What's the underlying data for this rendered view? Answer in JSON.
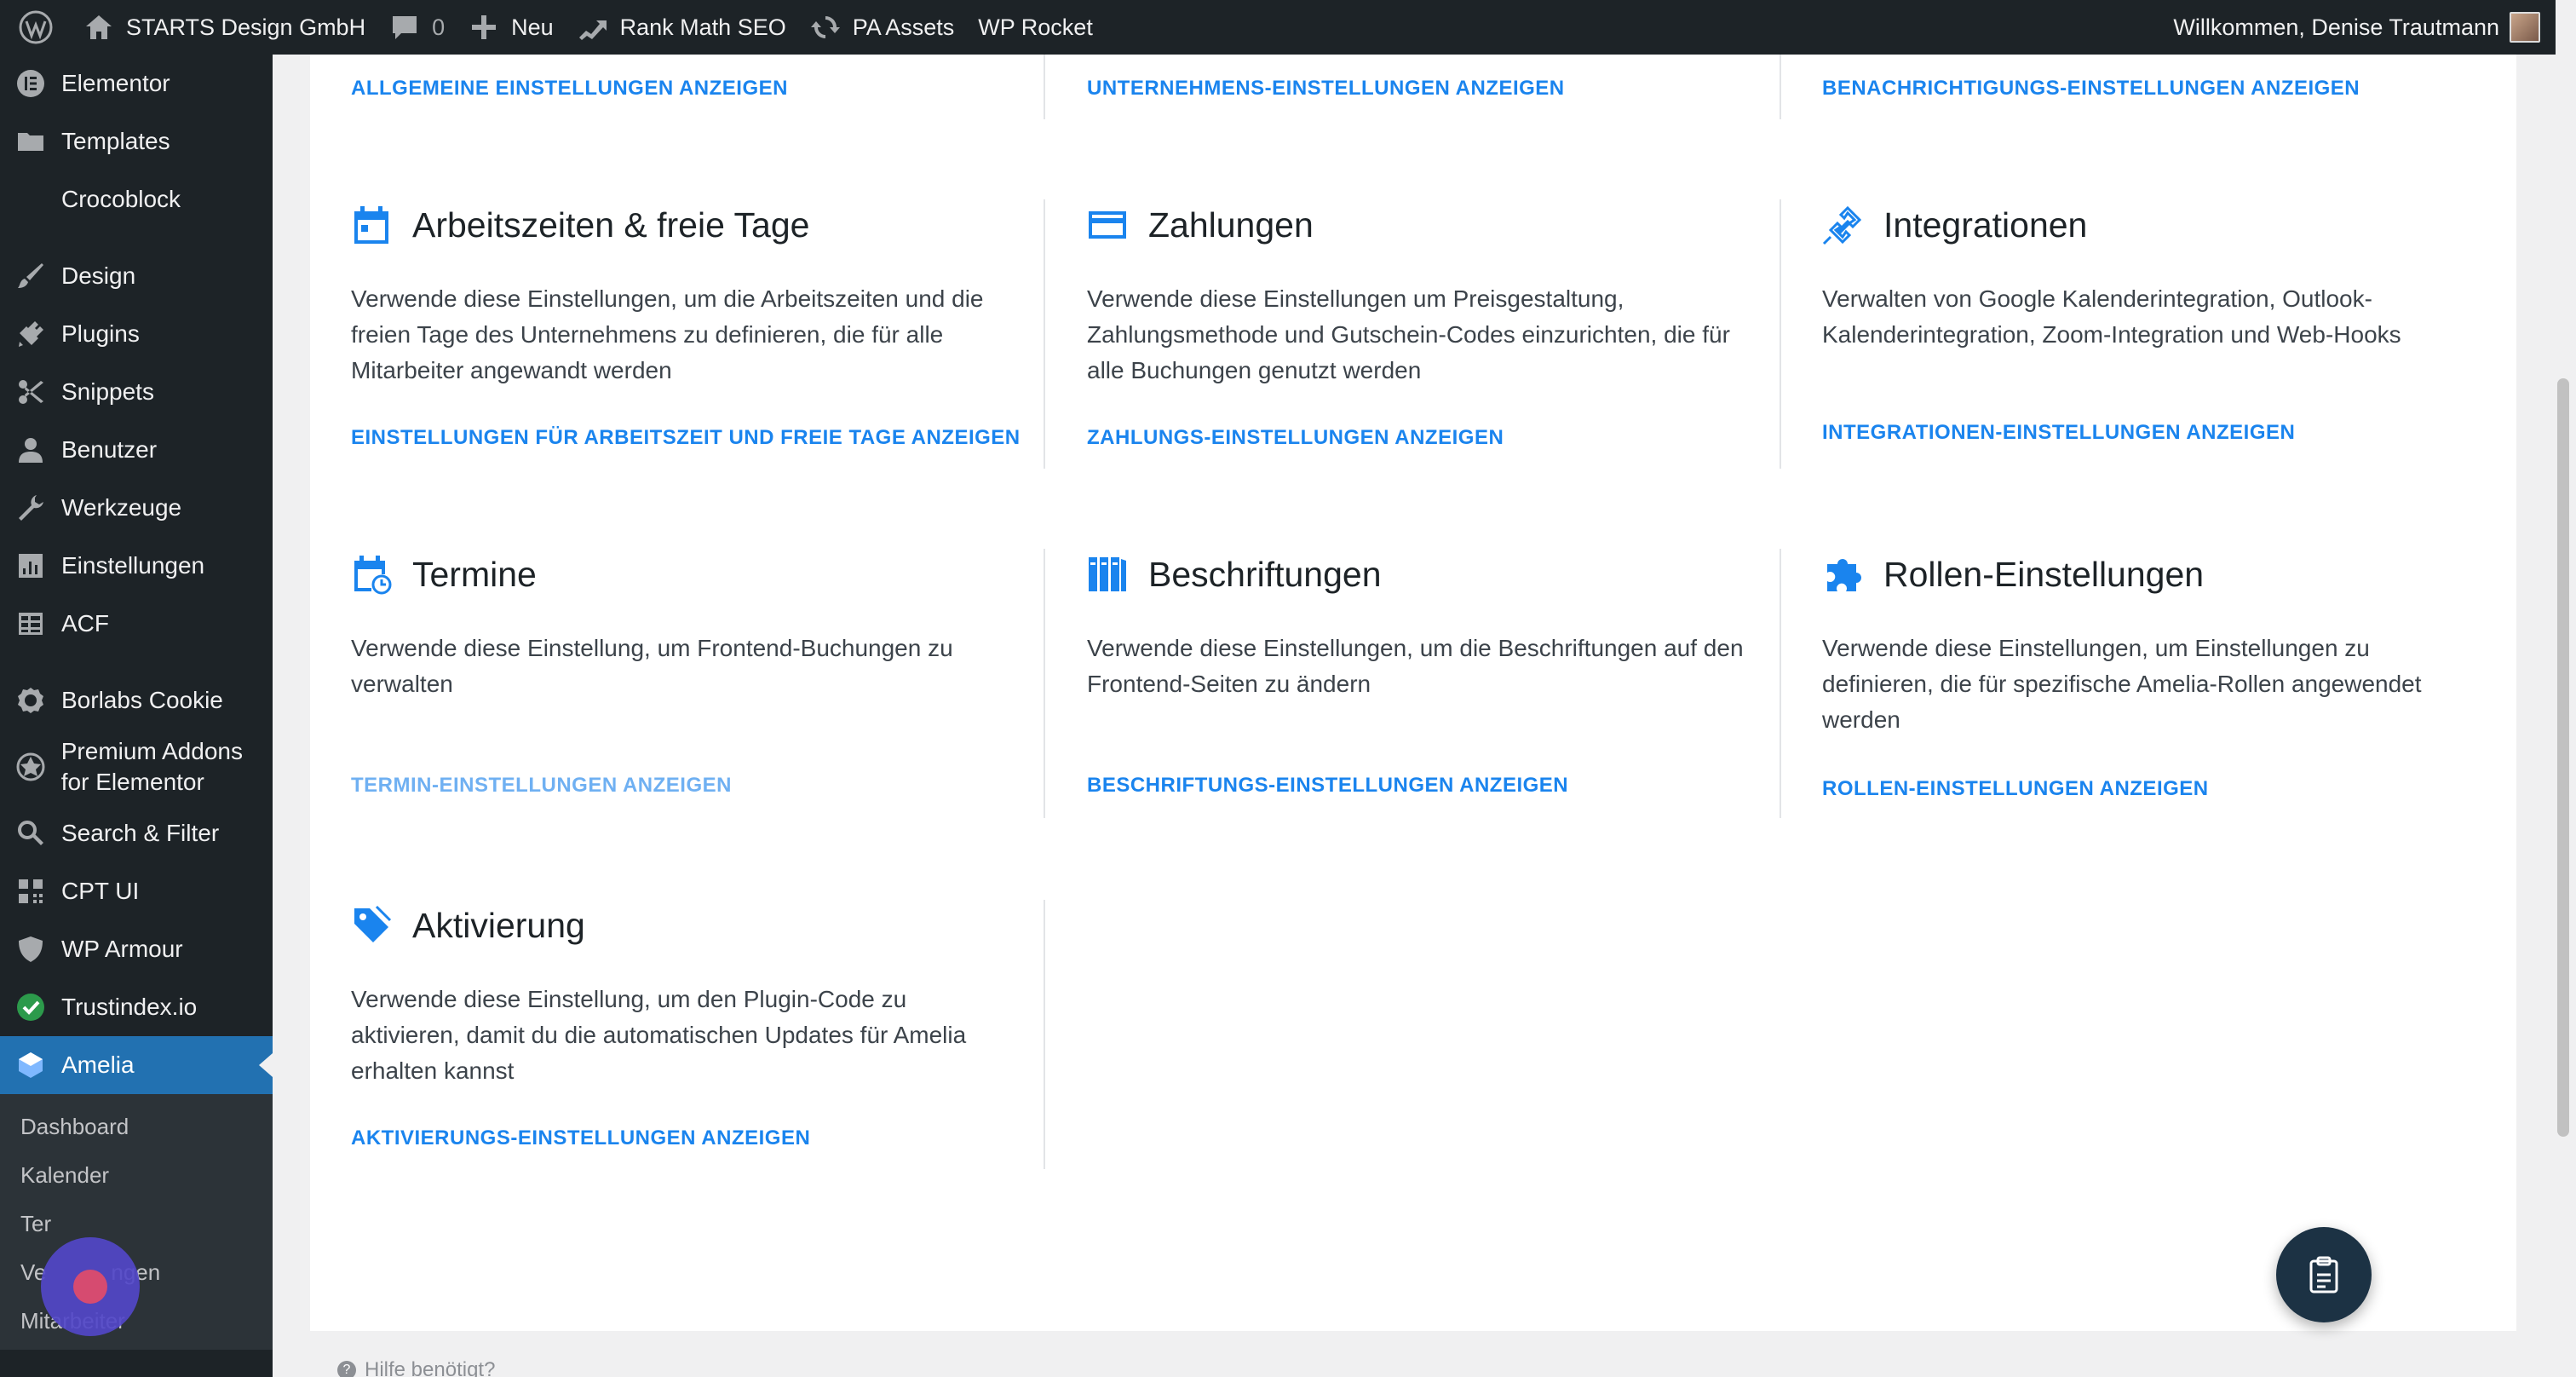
{
  "adminbar": {
    "site_name": "STARTS Design GmbH",
    "comments_count": "0",
    "new_label": "Neu",
    "rank_math": "Rank Math SEO",
    "pa_assets": "PA Assets",
    "wp_rocket": "WP Rocket",
    "greeting": "Willkommen, Denise Trautmann"
  },
  "sidebar": {
    "items": [
      {
        "label": "Elementor",
        "icon": "elementor-icon"
      },
      {
        "label": "Templates",
        "icon": "folder-icon"
      },
      {
        "label": "Crocoblock",
        "icon": "crocoblock-icon"
      },
      {
        "label": "Design",
        "icon": "brush-icon"
      },
      {
        "label": "Plugins",
        "icon": "plug-icon"
      },
      {
        "label": "Snippets",
        "icon": "scissors-icon"
      },
      {
        "label": "Benutzer",
        "icon": "user-icon"
      },
      {
        "label": "Werkzeuge",
        "icon": "wrench-icon"
      },
      {
        "label": "Einstellungen",
        "icon": "settings-icon"
      },
      {
        "label": "ACF",
        "icon": "grid-icon"
      },
      {
        "label": "Borlabs Cookie",
        "icon": "cookie-icon"
      },
      {
        "label": "Premium Addons for Elementor",
        "icon": "addons-icon"
      },
      {
        "label": "Search & Filter",
        "icon": "search-icon"
      },
      {
        "label": "CPT UI",
        "icon": "cpt-icon"
      },
      {
        "label": "WP Armour",
        "icon": "shield-icon"
      },
      {
        "label": "Trustindex.io",
        "icon": "check-circle-icon"
      },
      {
        "label": "Amelia",
        "icon": "amelia-icon"
      }
    ],
    "submenu": [
      "Dashboard",
      "Kalender",
      "Termine",
      "Veranstaltungen",
      "Mitarbeiter"
    ],
    "submenu_visible": [
      "Dashboard",
      "Kalender",
      "Ter",
      "Ve",
      "ngen",
      "Mitarbeiter"
    ]
  },
  "top_links": {
    "general": "ALLGEMEINE EINSTELLUNGEN ANZEIGEN",
    "company": "UNTERNEHMENS-EINSTELLUNGEN ANZEIGEN",
    "notifications": "BENACHRICHTIGUNGS-EINSTELLUNGEN ANZEIGEN"
  },
  "cards": {
    "work_hours": {
      "title": "Arbeitszeiten & freie Tage",
      "desc": "Verwende diese Einstellungen, um die Arbeitszeiten und die freien Tage des Unternehmens zu definieren, die für alle Mitarbeiter angewandt werden",
      "link": "EINSTELLUNGEN FÜR ARBEITSZEIT UND FREIE TAGE ANZEIGEN"
    },
    "payments": {
      "title": "Zahlungen",
      "desc": "Verwende diese Einstellungen um Preisgestaltung, Zahlungsmethode und Gutschein-Codes einzurichten, die für alle Buchungen genutzt werden",
      "link": "ZAHLUNGS-EINSTELLUNGEN ANZEIGEN"
    },
    "integrations": {
      "title": "Integrationen",
      "desc": "Verwalten von Google Kalenderintegration, Outlook-Kalenderintegration, Zoom-Integration und Web-Hooks",
      "link": "INTEGRATIONEN-EINSTELLUNGEN ANZEIGEN"
    },
    "appointments": {
      "title": "Termine",
      "desc": "Verwende diese Einstellung, um Frontend-Buchungen zu verwalten",
      "link": "TERMIN-EINSTELLUNGEN ANZEIGEN"
    },
    "labels": {
      "title": "Beschriftungen",
      "desc": "Verwende diese Einstellungen, um die Beschriftungen auf den Frontend-Seiten zu ändern",
      "link": "BESCHRIFTUNGS-EINSTELLUNGEN ANZEIGEN"
    },
    "roles": {
      "title": "Rollen-Einstellungen",
      "desc": "Verwende diese Einstellungen, um Einstellungen zu definieren, die für spezifische Amelia-Rollen angewendet werden",
      "link": "ROLLEN-EINSTELLUNGEN ANZEIGEN"
    },
    "activation": {
      "title": "Aktivierung",
      "desc": "Verwende diese Einstellung, um den Plugin-Code zu aktivieren, damit du die automatischen Updates für Amelia erhalten kannst",
      "link": "AKTIVIERUNGS-EINSTELLUNGEN ANZEIGEN"
    }
  },
  "footer": {
    "help": "Hilfe benötigt?"
  },
  "colors": {
    "accent": "#1a84ee",
    "adminbar": "#1d2327",
    "active_menu": "#2271b1"
  }
}
